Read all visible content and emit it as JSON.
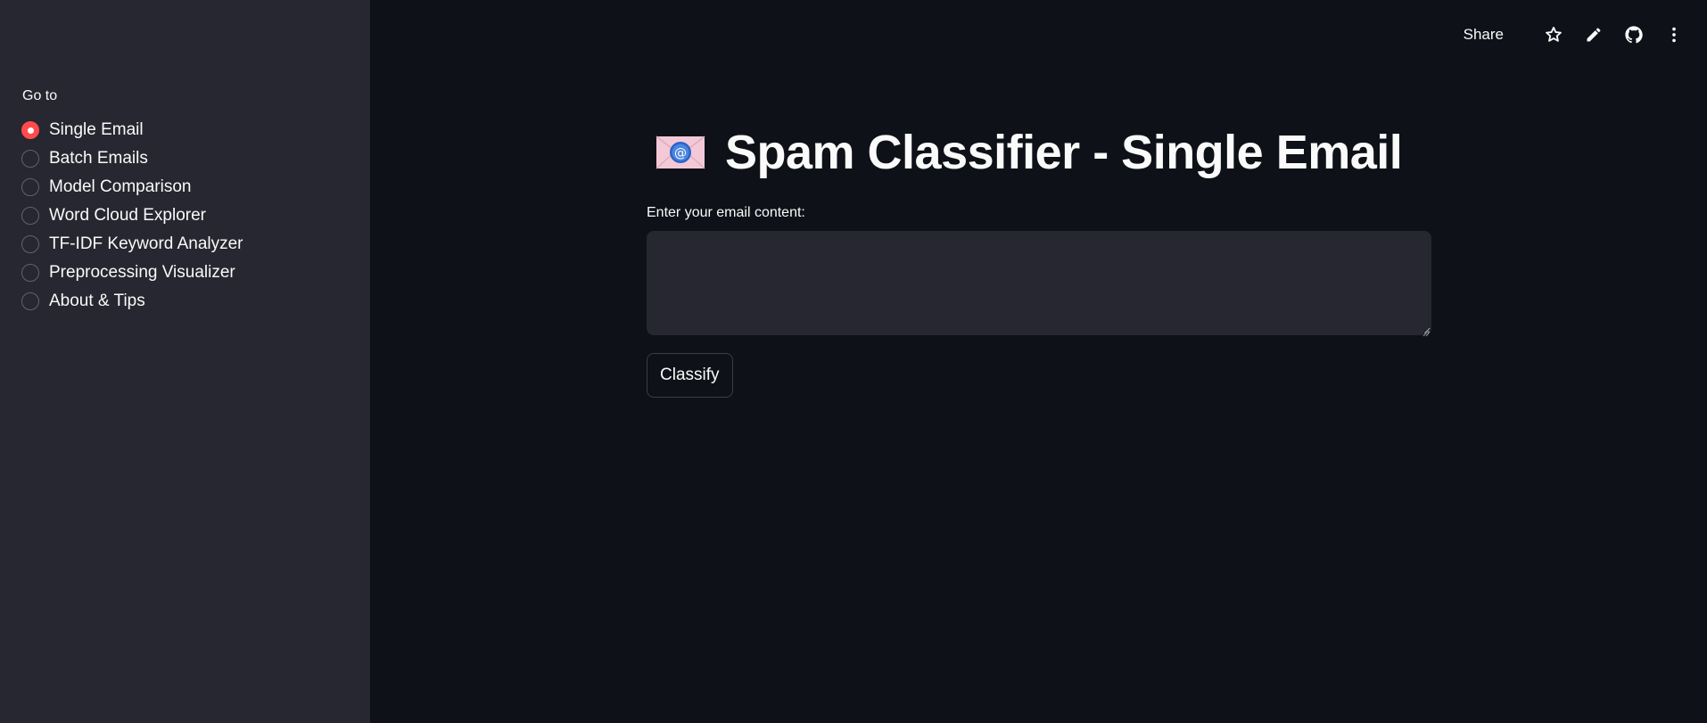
{
  "sidebar": {
    "heading": "Go to",
    "selected_index": 0,
    "items": [
      {
        "label": "Single Email"
      },
      {
        "label": "Batch Emails"
      },
      {
        "label": "Model Comparison"
      },
      {
        "label": "Word Cloud Explorer"
      },
      {
        "label": "TF-IDF Keyword Analyzer"
      },
      {
        "label": "Preprocessing Visualizer"
      },
      {
        "label": "About & Tips"
      }
    ]
  },
  "toolbar": {
    "share_label": "Share",
    "icons": [
      "star-icon",
      "pencil-icon",
      "github-icon",
      "more-vertical-icon"
    ]
  },
  "main": {
    "title_icon": "email-envelope-icon",
    "title": "Spam Classifier - Single Email",
    "input_label": "Enter your email content:",
    "input_value": "",
    "button_label": "Classify"
  },
  "colors": {
    "sidebar_bg": "#262730",
    "main_bg": "#0e1117",
    "accent": "#ff4b4b",
    "text": "#fafafa"
  }
}
